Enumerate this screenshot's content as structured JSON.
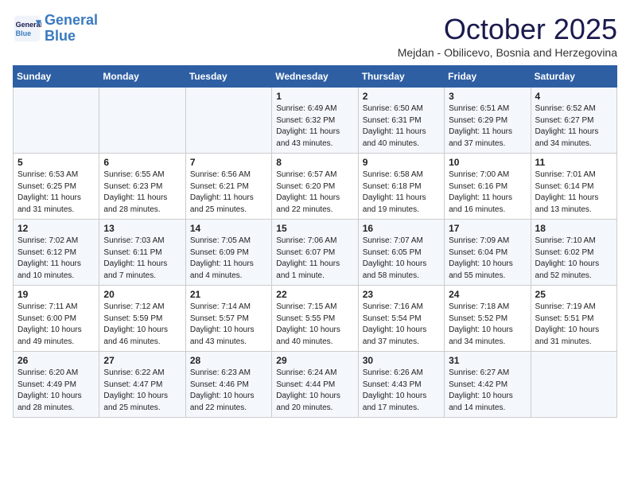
{
  "header": {
    "logo_line1": "General",
    "logo_line2": "Blue",
    "month": "October 2025",
    "location": "Mejdan - Obilicevo, Bosnia and Herzegovina"
  },
  "days_of_week": [
    "Sunday",
    "Monday",
    "Tuesday",
    "Wednesday",
    "Thursday",
    "Friday",
    "Saturday"
  ],
  "weeks": [
    [
      {
        "day": "",
        "info": ""
      },
      {
        "day": "",
        "info": ""
      },
      {
        "day": "",
        "info": ""
      },
      {
        "day": "1",
        "info": "Sunrise: 6:49 AM\nSunset: 6:32 PM\nDaylight: 11 hours\nand 43 minutes."
      },
      {
        "day": "2",
        "info": "Sunrise: 6:50 AM\nSunset: 6:31 PM\nDaylight: 11 hours\nand 40 minutes."
      },
      {
        "day": "3",
        "info": "Sunrise: 6:51 AM\nSunset: 6:29 PM\nDaylight: 11 hours\nand 37 minutes."
      },
      {
        "day": "4",
        "info": "Sunrise: 6:52 AM\nSunset: 6:27 PM\nDaylight: 11 hours\nand 34 minutes."
      }
    ],
    [
      {
        "day": "5",
        "info": "Sunrise: 6:53 AM\nSunset: 6:25 PM\nDaylight: 11 hours\nand 31 minutes."
      },
      {
        "day": "6",
        "info": "Sunrise: 6:55 AM\nSunset: 6:23 PM\nDaylight: 11 hours\nand 28 minutes."
      },
      {
        "day": "7",
        "info": "Sunrise: 6:56 AM\nSunset: 6:21 PM\nDaylight: 11 hours\nand 25 minutes."
      },
      {
        "day": "8",
        "info": "Sunrise: 6:57 AM\nSunset: 6:20 PM\nDaylight: 11 hours\nand 22 minutes."
      },
      {
        "day": "9",
        "info": "Sunrise: 6:58 AM\nSunset: 6:18 PM\nDaylight: 11 hours\nand 19 minutes."
      },
      {
        "day": "10",
        "info": "Sunrise: 7:00 AM\nSunset: 6:16 PM\nDaylight: 11 hours\nand 16 minutes."
      },
      {
        "day": "11",
        "info": "Sunrise: 7:01 AM\nSunset: 6:14 PM\nDaylight: 11 hours\nand 13 minutes."
      }
    ],
    [
      {
        "day": "12",
        "info": "Sunrise: 7:02 AM\nSunset: 6:12 PM\nDaylight: 11 hours\nand 10 minutes."
      },
      {
        "day": "13",
        "info": "Sunrise: 7:03 AM\nSunset: 6:11 PM\nDaylight: 11 hours\nand 7 minutes."
      },
      {
        "day": "14",
        "info": "Sunrise: 7:05 AM\nSunset: 6:09 PM\nDaylight: 11 hours\nand 4 minutes."
      },
      {
        "day": "15",
        "info": "Sunrise: 7:06 AM\nSunset: 6:07 PM\nDaylight: 11 hours\nand 1 minute."
      },
      {
        "day": "16",
        "info": "Sunrise: 7:07 AM\nSunset: 6:05 PM\nDaylight: 10 hours\nand 58 minutes."
      },
      {
        "day": "17",
        "info": "Sunrise: 7:09 AM\nSunset: 6:04 PM\nDaylight: 10 hours\nand 55 minutes."
      },
      {
        "day": "18",
        "info": "Sunrise: 7:10 AM\nSunset: 6:02 PM\nDaylight: 10 hours\nand 52 minutes."
      }
    ],
    [
      {
        "day": "19",
        "info": "Sunrise: 7:11 AM\nSunset: 6:00 PM\nDaylight: 10 hours\nand 49 minutes."
      },
      {
        "day": "20",
        "info": "Sunrise: 7:12 AM\nSunset: 5:59 PM\nDaylight: 10 hours\nand 46 minutes."
      },
      {
        "day": "21",
        "info": "Sunrise: 7:14 AM\nSunset: 5:57 PM\nDaylight: 10 hours\nand 43 minutes."
      },
      {
        "day": "22",
        "info": "Sunrise: 7:15 AM\nSunset: 5:55 PM\nDaylight: 10 hours\nand 40 minutes."
      },
      {
        "day": "23",
        "info": "Sunrise: 7:16 AM\nSunset: 5:54 PM\nDaylight: 10 hours\nand 37 minutes."
      },
      {
        "day": "24",
        "info": "Sunrise: 7:18 AM\nSunset: 5:52 PM\nDaylight: 10 hours\nand 34 minutes."
      },
      {
        "day": "25",
        "info": "Sunrise: 7:19 AM\nSunset: 5:51 PM\nDaylight: 10 hours\nand 31 minutes."
      }
    ],
    [
      {
        "day": "26",
        "info": "Sunrise: 6:20 AM\nSunset: 4:49 PM\nDaylight: 10 hours\nand 28 minutes."
      },
      {
        "day": "27",
        "info": "Sunrise: 6:22 AM\nSunset: 4:47 PM\nDaylight: 10 hours\nand 25 minutes."
      },
      {
        "day": "28",
        "info": "Sunrise: 6:23 AM\nSunset: 4:46 PM\nDaylight: 10 hours\nand 22 minutes."
      },
      {
        "day": "29",
        "info": "Sunrise: 6:24 AM\nSunset: 4:44 PM\nDaylight: 10 hours\nand 20 minutes."
      },
      {
        "day": "30",
        "info": "Sunrise: 6:26 AM\nSunset: 4:43 PM\nDaylight: 10 hours\nand 17 minutes."
      },
      {
        "day": "31",
        "info": "Sunrise: 6:27 AM\nSunset: 4:42 PM\nDaylight: 10 hours\nand 14 minutes."
      },
      {
        "day": "",
        "info": ""
      }
    ]
  ]
}
